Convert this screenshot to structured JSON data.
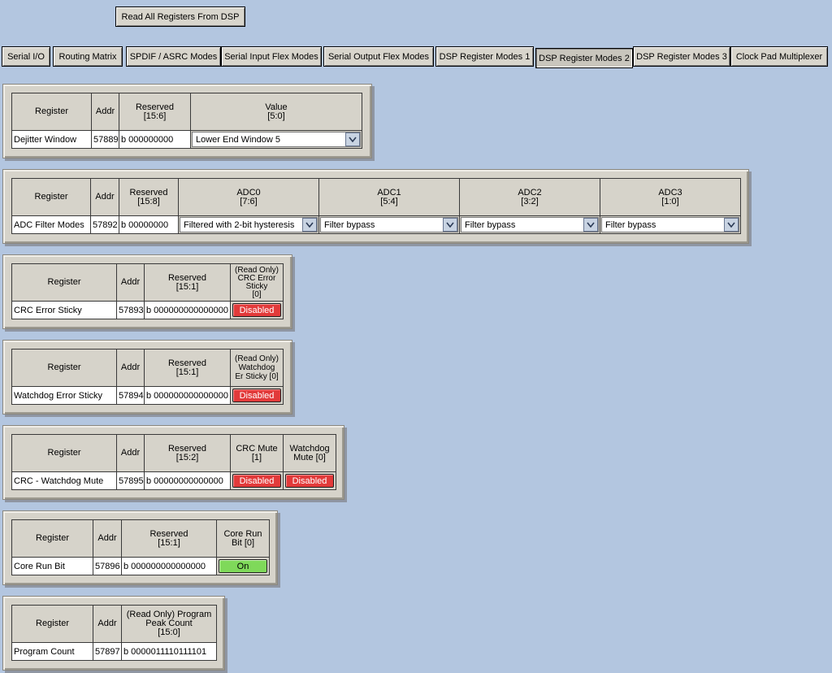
{
  "toolbar": {
    "read_all": "Read All Registers From DSP"
  },
  "tabs": [
    {
      "label": "Serial I/O"
    },
    {
      "label": "Routing Matrix"
    },
    {
      "label": "SPDIF / ASRC Modes"
    },
    {
      "label": "Serial Input Flex Modes"
    },
    {
      "label": "Serial Output Flex Modes"
    },
    {
      "label": "DSP Register Modes 1"
    },
    {
      "label": "DSP Register Modes 2",
      "active": true
    },
    {
      "label": "DSP Register Modes 3"
    },
    {
      "label": "Clock Pad Multiplexer"
    }
  ],
  "panels": {
    "dejitter": {
      "headers": [
        "Register",
        "Addr",
        "Reserved\n[15:6]",
        "Value\n[5:0]"
      ],
      "register": "Dejitter Window",
      "addr": "57889",
      "reserved": "b 000000000",
      "value": "Lower End Window 5"
    },
    "adc": {
      "headers": [
        "Register",
        "Addr",
        "Reserved\n[15:8]",
        "ADC0\n[7:6]",
        "ADC1\n[5:4]",
        "ADC2\n[3:2]",
        "ADC3\n[1:0]"
      ],
      "register": "ADC Filter Modes",
      "addr": "57892",
      "reserved": "b 00000000",
      "values": [
        "Filtered with 2-bit hysteresis",
        "Filter bypass",
        "Filter bypass",
        "Filter bypass"
      ]
    },
    "crc": {
      "headers": [
        "Register",
        "Addr",
        "Reserved\n[15:1]",
        "(Read Only)\nCRC Error\nSticky\n[0]"
      ],
      "register": "CRC Error Sticky",
      "addr": "57893",
      "reserved": "b 000000000000000",
      "status": "Disabled"
    },
    "watchdog": {
      "headers": [
        "Register",
        "Addr",
        "Reserved\n[15:1]",
        "(Read Only)\nWatchdog\nEr Sticky [0]"
      ],
      "register": "Watchdog Error Sticky",
      "addr": "57894",
      "reserved": "b 000000000000000",
      "status": "Disabled"
    },
    "mute": {
      "headers": [
        "Register",
        "Addr",
        "Reserved\n[15:2]",
        "CRC Mute\n[1]",
        "Watchdog\nMute [0]"
      ],
      "register": "CRC - Watchdog Mute",
      "addr": "57895",
      "reserved": "b 00000000000000",
      "status1": "Disabled",
      "status2": "Disabled"
    },
    "core": {
      "headers": [
        "Register",
        "Addr",
        "Reserved\n[15:1]",
        "Core Run\nBit [0]"
      ],
      "register": "Core Run Bit",
      "addr": "57896",
      "reserved": "b 000000000000000",
      "status": "On"
    },
    "program": {
      "headers": [
        "Register",
        "Addr",
        "(Read Only) Program\nPeak Count\n[15:0]"
      ],
      "register": "Program Count",
      "addr": "57897",
      "value": "b 0000011110111101"
    }
  },
  "colors": {
    "background": "#b3c6e0",
    "disabled": "#e23a3a",
    "on": "#7fd95a"
  },
  "icons": {
    "dropdown": "chevron-down-icon"
  }
}
